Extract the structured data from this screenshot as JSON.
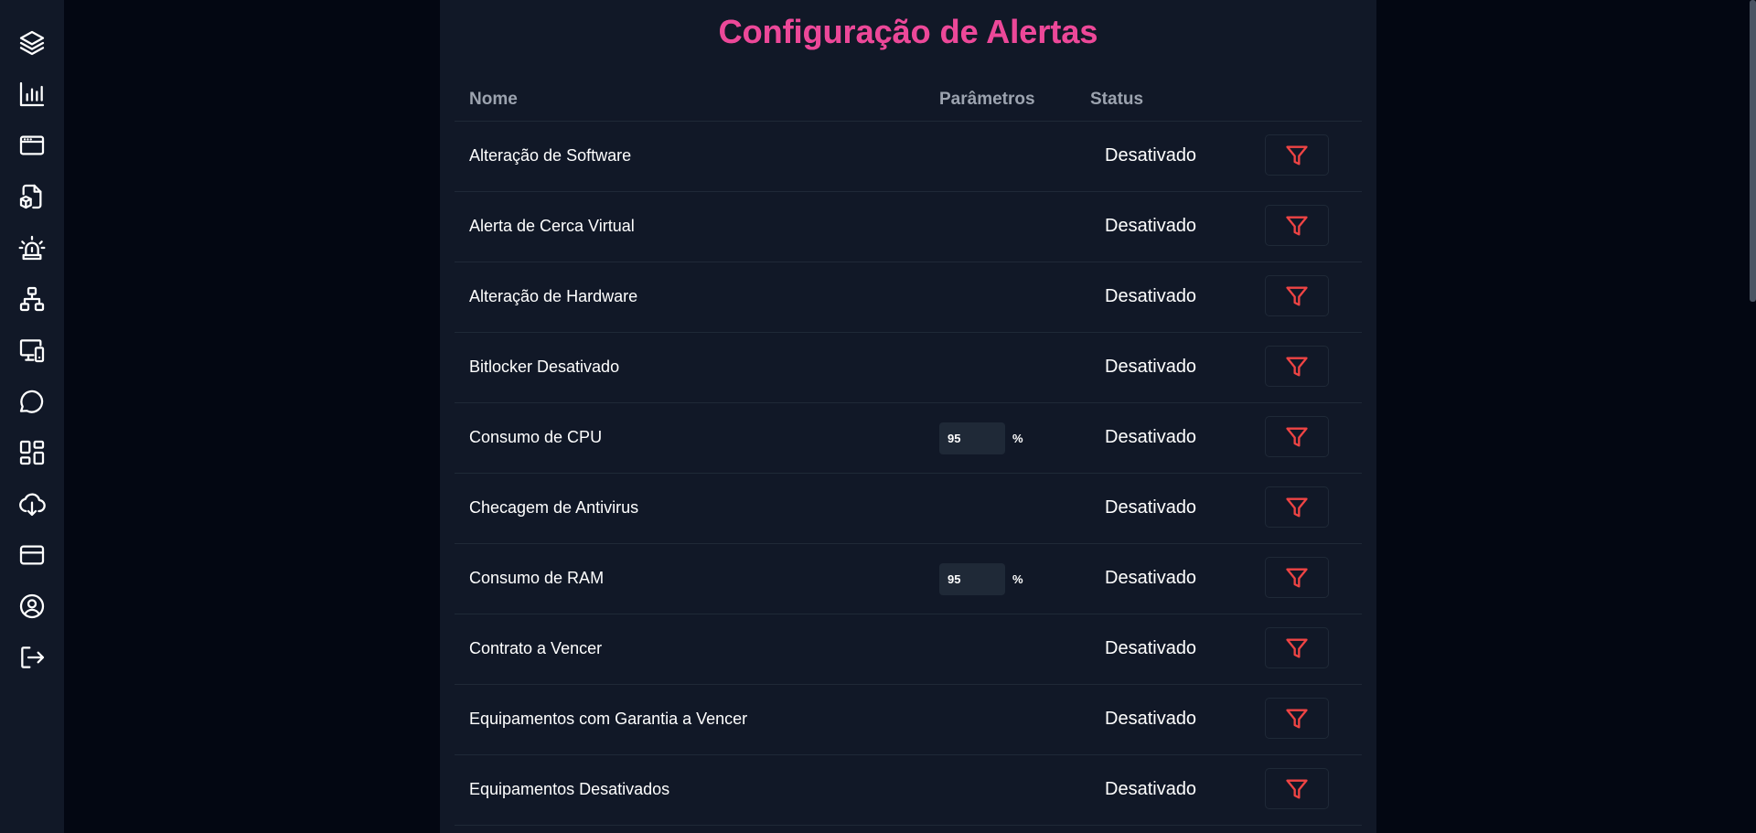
{
  "sidebar": {
    "items": [
      {
        "name": "layers-icon"
      },
      {
        "name": "bar-chart-icon"
      },
      {
        "name": "browser-window-icon"
      },
      {
        "name": "file-package-icon"
      },
      {
        "name": "alarm-siren-icon"
      },
      {
        "name": "network-hierarchy-icon"
      },
      {
        "name": "devices-icon"
      },
      {
        "name": "chat-bubble-icon"
      },
      {
        "name": "dashboard-layout-icon"
      },
      {
        "name": "cloud-download-icon"
      },
      {
        "name": "credit-card-icon"
      },
      {
        "name": "user-circle-icon"
      },
      {
        "name": "logout-icon"
      }
    ]
  },
  "page": {
    "title": "Configuração de Alertas"
  },
  "table": {
    "headers": {
      "name": "Nome",
      "params": "Parâmetros",
      "status": "Status"
    },
    "rows": [
      {
        "name": "Alteração de Software",
        "status": "Desativado"
      },
      {
        "name": "Alerta de Cerca Virtual",
        "status": "Desativado"
      },
      {
        "name": "Alteração de Hardware",
        "status": "Desativado"
      },
      {
        "name": "Bitlocker Desativado",
        "status": "Desativado"
      },
      {
        "name": "Consumo de CPU",
        "param": "95",
        "unit": "%",
        "status": "Desativado"
      },
      {
        "name": "Checagem de Antivirus",
        "status": "Desativado"
      },
      {
        "name": "Consumo de RAM",
        "param": "95",
        "unit": "%",
        "status": "Desativado"
      },
      {
        "name": "Contrato a Vencer",
        "status": "Desativado"
      },
      {
        "name": "Equipamentos com Garantia a Vencer",
        "status": "Desativado"
      },
      {
        "name": "Equipamentos Desativados",
        "status": "Desativado"
      }
    ]
  },
  "colors": {
    "title": "#ec4899",
    "filter_icon": "#ef4444",
    "panel_bg": "#111827",
    "page_bg": "#030712"
  }
}
